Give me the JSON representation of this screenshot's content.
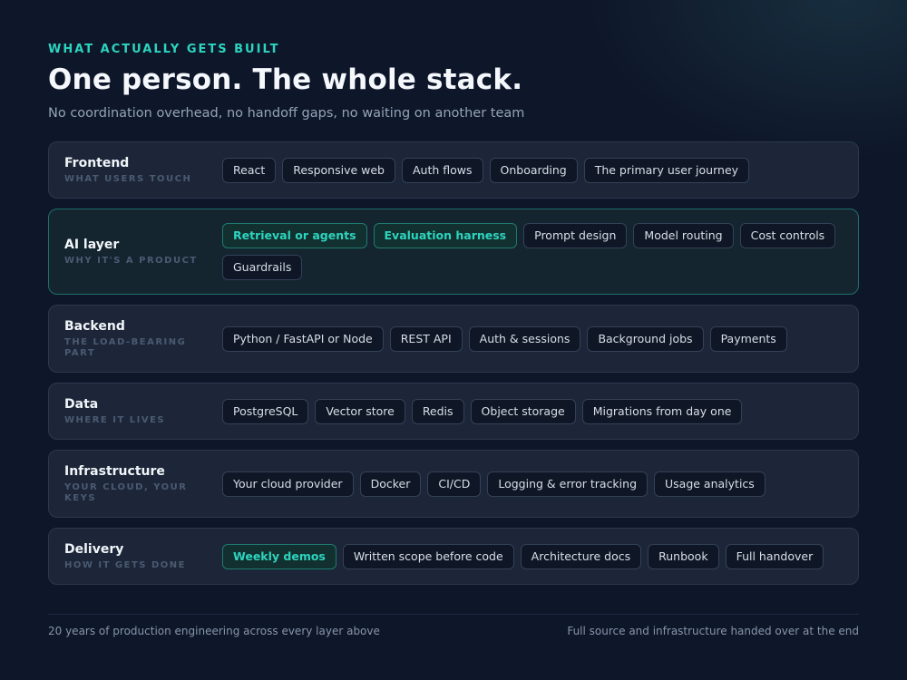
{
  "header": {
    "eyebrow": "WHAT ACTUALLY GETS BUILT",
    "title": "One person. The whole stack.",
    "subtitle": "No coordination overhead, no handoff gaps, no waiting on another team"
  },
  "colors": {
    "accent": "#2dd4bf",
    "background": "#0e1629",
    "card": "#1c2638"
  },
  "layers": [
    {
      "name": "Frontend",
      "sub": "WHAT USERS TOUCH",
      "chips": [
        {
          "label": "React",
          "accent": false
        },
        {
          "label": "Responsive web",
          "accent": false
        },
        {
          "label": "Auth flows",
          "accent": false
        },
        {
          "label": "Onboarding",
          "accent": false
        },
        {
          "label": "The primary user journey",
          "accent": false
        }
      ]
    },
    {
      "name": "AI layer",
      "sub": "WHY IT'S A PRODUCT",
      "highlight": true,
      "chips": [
        {
          "label": "Retrieval or agents",
          "accent": true
        },
        {
          "label": "Evaluation harness",
          "accent": true
        },
        {
          "label": "Prompt design",
          "accent": false
        },
        {
          "label": "Model routing",
          "accent": false
        },
        {
          "label": "Cost controls",
          "accent": false
        },
        {
          "label": "Guardrails",
          "accent": false
        }
      ]
    },
    {
      "name": "Backend",
      "sub": "THE LOAD-BEARING PART",
      "chips": [
        {
          "label": "Python / FastAPI or Node",
          "accent": false
        },
        {
          "label": "REST API",
          "accent": false
        },
        {
          "label": "Auth & sessions",
          "accent": false
        },
        {
          "label": "Background jobs",
          "accent": false
        },
        {
          "label": "Payments",
          "accent": false
        }
      ]
    },
    {
      "name": "Data",
      "sub": "WHERE IT LIVES",
      "chips": [
        {
          "label": "PostgreSQL",
          "accent": false
        },
        {
          "label": "Vector store",
          "accent": false
        },
        {
          "label": "Redis",
          "accent": false
        },
        {
          "label": "Object storage",
          "accent": false
        },
        {
          "label": "Migrations from day one",
          "accent": false
        }
      ]
    },
    {
      "name": "Infrastructure",
      "sub": "YOUR CLOUD, YOUR KEYS",
      "chips": [
        {
          "label": "Your cloud provider",
          "accent": false
        },
        {
          "label": "Docker",
          "accent": false
        },
        {
          "label": "CI/CD",
          "accent": false
        },
        {
          "label": "Logging & error tracking",
          "accent": false
        },
        {
          "label": "Usage analytics",
          "accent": false
        }
      ]
    },
    {
      "name": "Delivery",
      "sub": "HOW IT GETS DONE",
      "chips": [
        {
          "label": "Weekly demos",
          "accent": true
        },
        {
          "label": "Written scope before code",
          "accent": false
        },
        {
          "label": "Architecture docs",
          "accent": false
        },
        {
          "label": "Runbook",
          "accent": false
        },
        {
          "label": "Full handover",
          "accent": false
        }
      ]
    }
  ],
  "footer": {
    "left": "20 years of production engineering across every layer above",
    "right": "Full source and infrastructure handed over at the end"
  }
}
